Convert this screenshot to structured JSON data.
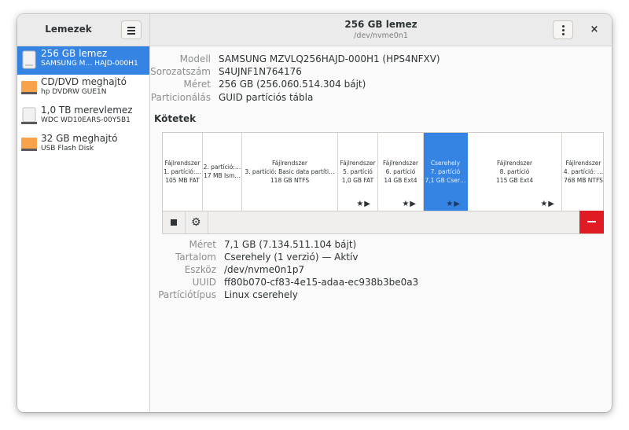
{
  "sidebar": {
    "title": "Lemezek",
    "disks": [
      {
        "name": "256 GB lemez",
        "sub": "SAMSUNG M… HAJD-000H1",
        "icon": "ssd-drive-icon"
      },
      {
        "name": "CD/DVD meghajtó",
        "sub": "hp DVDRW GUE1N",
        "icon": "optical-drive-icon"
      },
      {
        "name": "1,0 TB merevlemez",
        "sub": "WDC WD10EARS-00Y5B1",
        "icon": "hard-disk-icon"
      },
      {
        "name": "32 GB meghajtó",
        "sub": "USB Flash Disk",
        "icon": "usb-drive-icon"
      }
    ]
  },
  "header": {
    "title": "256 GB lemez",
    "subtitle": "/dev/nvme0n1",
    "close_label": "×"
  },
  "disk_info": {
    "labels": [
      "Modell",
      "Sorozatszám",
      "Méret",
      "Particionálás"
    ],
    "values": [
      "SAMSUNG MZVLQ256HAJD-000H1 (HPS4NFXV)",
      "S4UJNF1N764176",
      "256 GB (256.060.514.304 bájt)",
      "GUID partíciós tábla"
    ]
  },
  "volumes_title": "Kötetek",
  "partitions": [
    {
      "l1": "Fájlrendszer",
      "l2": "1. partíció:…",
      "l3": "105 MB FAT",
      "icons": ""
    },
    {
      "l1": "",
      "l2": "2. partíció:…",
      "l3": "17 MB Ism…",
      "icons": ""
    },
    {
      "l1": "Fájlrendszer",
      "l2": "3. partíció: Basic data partíti…",
      "l3": "118 GB NTFS",
      "icons": ""
    },
    {
      "l1": "Fájlrendszer",
      "l2": "5. partíció",
      "l3": "1,0 GB FAT",
      "icons": "★▶"
    },
    {
      "l1": "Fájlrendszer",
      "l2": "6. partíció",
      "l3": "14 GB Ext4",
      "icons": "★▶"
    },
    {
      "l1": "Cserehely",
      "l2": "7. partíció",
      "l3": "7,1 GB Cser…",
      "icons": "★▶"
    },
    {
      "l1": "Fájlrendszer",
      "l2": "8. partíció",
      "l3": "115 GB Ext4",
      "icons": "★▶"
    },
    {
      "l1": "Fájlrendszer",
      "l2": "4. partíció: …",
      "l3": "768 MB NTFS",
      "icons": ""
    }
  ],
  "selected_partition": {
    "labels": [
      "Méret",
      "Tartalom",
      "Eszköz",
      "UUID",
      "Partíciótípus"
    ],
    "values": [
      "7,1 GB (7.134.511.104 bájt)",
      "Cserehely (1 verzió) — Aktív",
      "/dev/nvme0n1p7",
      "ff80b070-cf83-4e15-adaa-ec938b3be0a3",
      "Linux cserehely"
    ]
  },
  "colors": {
    "accent": "#3584e4",
    "destructive": "#e01b24"
  }
}
